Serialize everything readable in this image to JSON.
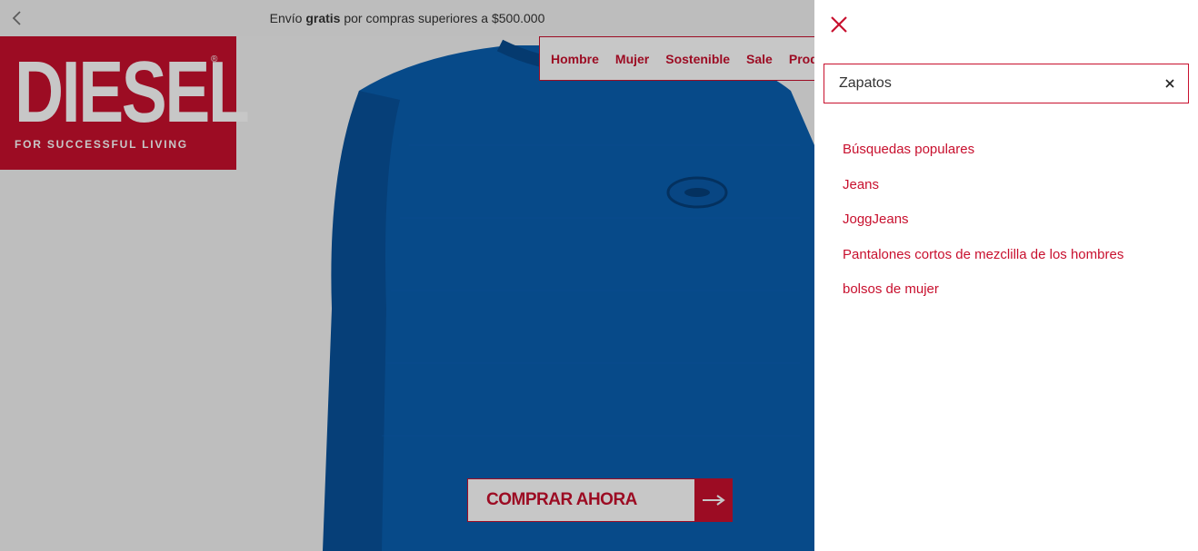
{
  "promo": {
    "prefix": "Envío ",
    "bold": "gratis",
    "suffix": " por compras superiores a $500.000"
  },
  "brand": {
    "name": "DIESEL",
    "registered": "®",
    "tagline": "FOR SUCCESSFUL LIVING"
  },
  "nav": {
    "items": [
      "Hombre",
      "Mujer",
      "Sostenible",
      "Sale",
      "Produ"
    ]
  },
  "hero": {
    "cta_label": "COMPRAR AHORA"
  },
  "search": {
    "value": "Zapatos",
    "placeholder": ""
  },
  "suggestions": {
    "items": [
      "Búsquedas populares",
      "Jeans",
      "JoggJeans",
      "Pantalones cortos de mezclilla de los hombres",
      "bolsos de mujer"
    ]
  },
  "colors": {
    "brand_red": "#c8102e",
    "sweater_blue": "#0a5fb0",
    "overlay": "rgba(0,0,0,0.22)"
  },
  "icons": {
    "back": "chevron-left-icon",
    "close": "close-icon",
    "clear": "clear-icon",
    "arrow": "arrow-right-icon"
  }
}
